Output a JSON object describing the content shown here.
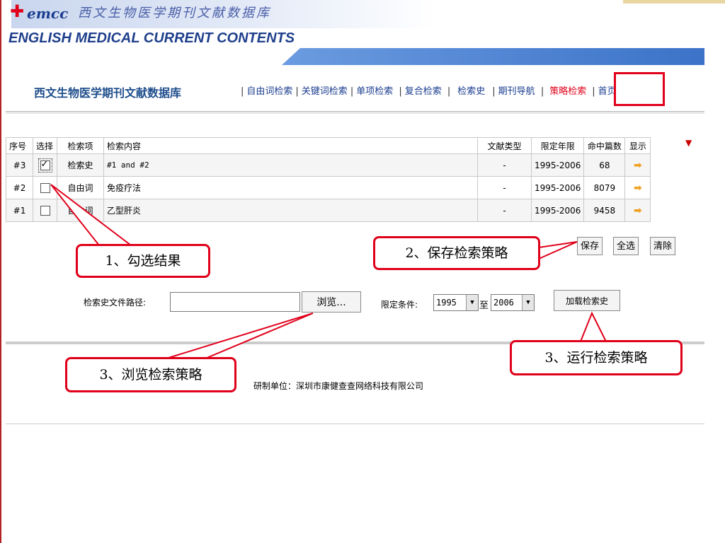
{
  "header": {
    "logo_mark": "✚",
    "logo_emcc": "emcc",
    "logo_cn": "西文生物医学期刊文献数据库",
    "logo_en": "ENGLISH MEDICAL CURRENT CONTENTS"
  },
  "site_title": "西文生物医学期刊文献数据库",
  "nav": {
    "items": [
      "自由词检索",
      "关键词检索",
      "单项检索",
      "复合检索",
      "检索史",
      "期刊导航",
      "策略检索",
      "首页"
    ],
    "active": "策略检索"
  },
  "table": {
    "headers": [
      "序号",
      "选择",
      "检索项",
      "检索内容",
      "文献类型",
      "限定年限",
      "命中篇数",
      "显示"
    ],
    "rows": [
      {
        "id": "#3",
        "checked": true,
        "field": "检索史",
        "content": "#1 and #2",
        "type": "-",
        "years": "1995-2006",
        "hits": "68"
      },
      {
        "id": "#2",
        "checked": false,
        "field": "自由词",
        "content": "免疫疗法",
        "type": "-",
        "years": "1995-2006",
        "hits": "8079"
      },
      {
        "id": "#1",
        "checked": false,
        "field": "自由词",
        "content": "乙型肝炎",
        "type": "-",
        "years": "1995-2006",
        "hits": "9458"
      }
    ],
    "show_icon": "arrow-right-icon",
    "show_glyph": "➡",
    "header_marker": "▼"
  },
  "actions": {
    "save": "保存",
    "select_all": "全选",
    "clear": "清除"
  },
  "history_file": {
    "label": "检索史文件路径:",
    "value": "",
    "browse": "浏览...",
    "limit_label": "限定条件:",
    "from_year": "1995",
    "to_label": "至",
    "to_year": "2006",
    "load": "加载检索史"
  },
  "footer": "研制单位：深圳市康健查查网络科技有限公司",
  "callouts": {
    "c1": "1、勾选结果",
    "c2": "2、保存检索策略",
    "c3a": "3、运行检索策略",
    "c3b": "3、浏览检索策略"
  },
  "colors": {
    "accent_red": "#e0001a",
    "nav_blue": "#1a3d8f",
    "bar_blue": "#4a7fd0",
    "arrow_orange": "#f0a020"
  }
}
